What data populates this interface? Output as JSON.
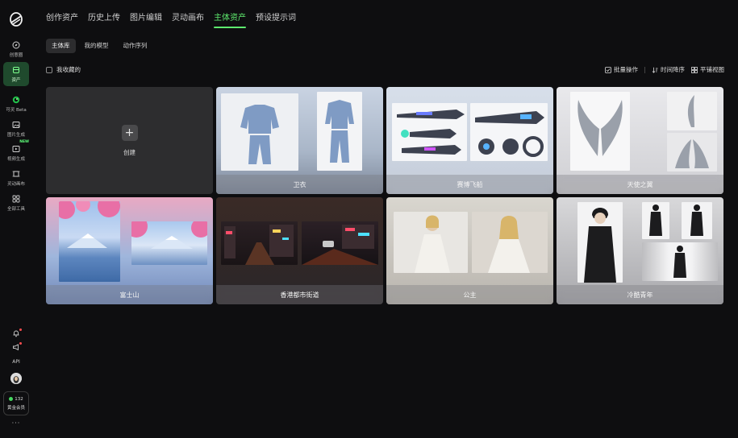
{
  "sidebar": {
    "items": [
      {
        "label": "创意圈",
        "icon": "compass-icon"
      },
      {
        "label": "资产",
        "icon": "asset-icon"
      },
      {
        "label": "可灵 Beta",
        "icon": "kling-logo-icon"
      },
      {
        "label": "图片生成",
        "icon": "image-icon"
      },
      {
        "label": "视频生成",
        "icon": "video-icon",
        "badge": "NEW"
      },
      {
        "label": "灵动画布",
        "icon": "canvas-icon"
      },
      {
        "label": "全部工具",
        "icon": "grid-icon"
      }
    ],
    "api_label": "API",
    "points": "132",
    "member_label": "黄金会员",
    "more": "···"
  },
  "topnav": {
    "tabs": [
      "创作资产",
      "历史上传",
      "图片编辑",
      "灵动画布",
      "主体资产",
      "预设提示词"
    ],
    "active_index": 4
  },
  "subtabs": {
    "tabs": [
      "主体库",
      "我的模型",
      "动作序列"
    ],
    "active_index": 0
  },
  "toolbar": {
    "favorites_label": "我收藏的",
    "batch_label": "批量操作",
    "sort_label": "时间降序",
    "view_label": "平铺视图"
  },
  "grid": {
    "create_label": "创建",
    "cards": [
      {
        "label": "卫衣"
      },
      {
        "label": "赛博飞船"
      },
      {
        "label": "天使之翼"
      },
      {
        "label": "富士山"
      },
      {
        "label": "香港都市街道"
      },
      {
        "label": "公主"
      },
      {
        "label": "冷酷青年"
      }
    ]
  },
  "colors": {
    "accent": "#5eea6e",
    "background": "#0e0e10",
    "card": "#2a2a2c",
    "active_side": "#1f4a2d"
  }
}
